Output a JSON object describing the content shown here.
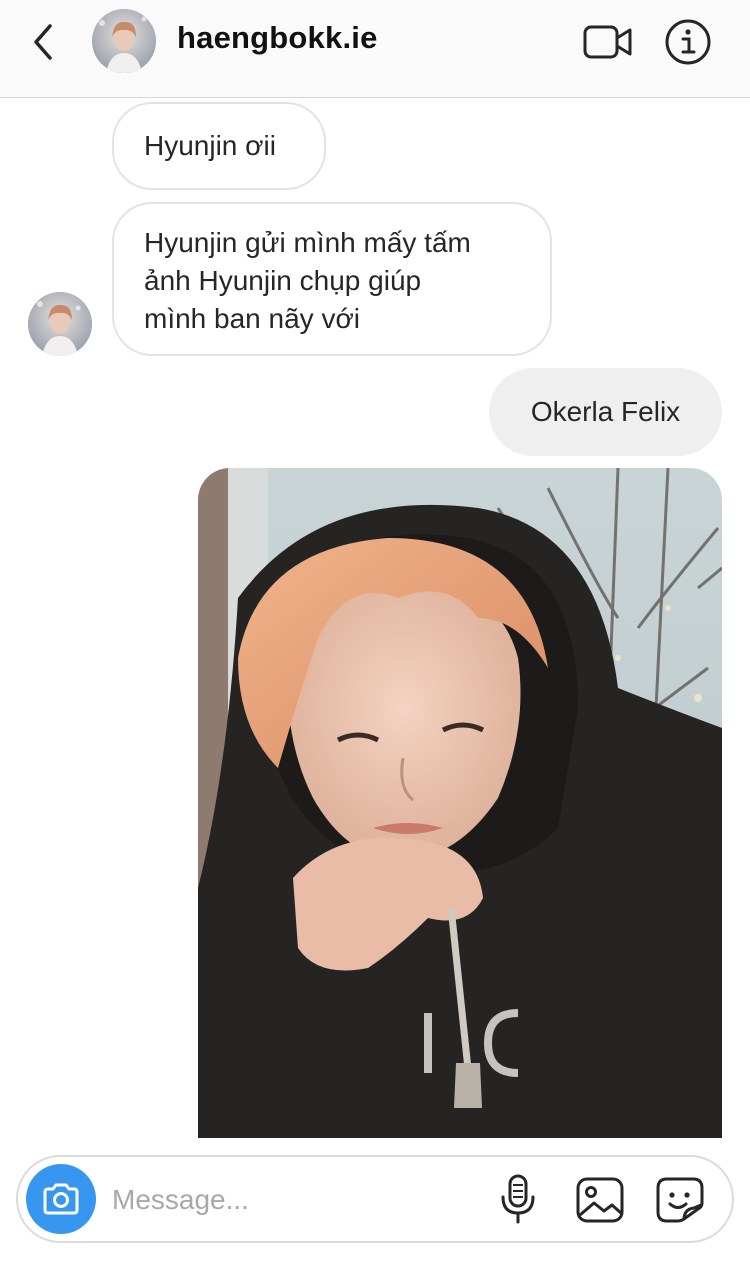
{
  "header": {
    "username": "haengbokk.ie",
    "back_icon": "chevron-left-icon",
    "video_icon": "video-camera-icon",
    "info_icon": "info-icon"
  },
  "messages": [
    {
      "direction": "incoming",
      "text": "Hyunjin ơii"
    },
    {
      "direction": "incoming",
      "lines": [
        "Hyunjin gửi mình mấy tấm",
        "ảnh Hyunjin chụp giúp",
        "mình ban nãy với"
      ]
    },
    {
      "direction": "outgoing",
      "text": "Okerla Felix"
    },
    {
      "direction": "outgoing",
      "type": "photo"
    }
  ],
  "composer": {
    "placeholder": "Message...",
    "camera_icon": "camera-icon",
    "mic_icon": "microphone-icon",
    "gallery_icon": "gallery-icon",
    "sticker_icon": "sticker-icon"
  },
  "colors": {
    "accent": "#3797f0",
    "outgoing_bubble": "#efefef",
    "incoming_border": "#e3e3e3",
    "header_bg": "#fafafa"
  }
}
